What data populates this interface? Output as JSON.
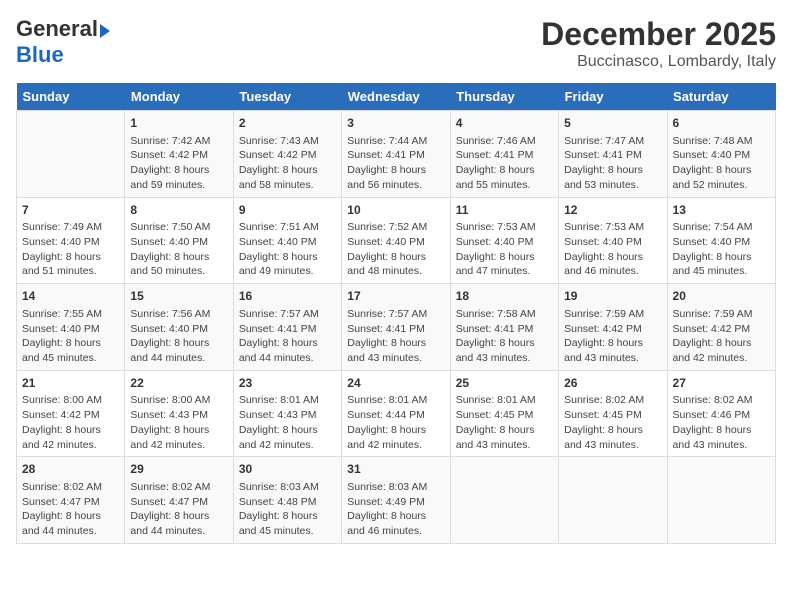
{
  "header": {
    "logo_general": "General",
    "logo_blue": "Blue",
    "title": "December 2025",
    "subtitle": "Buccinasco, Lombardy, Italy"
  },
  "days_of_week": [
    "Sunday",
    "Monday",
    "Tuesday",
    "Wednesday",
    "Thursday",
    "Friday",
    "Saturday"
  ],
  "weeks": [
    [
      {
        "day": "",
        "content": ""
      },
      {
        "day": "1",
        "content": "Sunrise: 7:42 AM\nSunset: 4:42 PM\nDaylight: 8 hours\nand 59 minutes."
      },
      {
        "day": "2",
        "content": "Sunrise: 7:43 AM\nSunset: 4:42 PM\nDaylight: 8 hours\nand 58 minutes."
      },
      {
        "day": "3",
        "content": "Sunrise: 7:44 AM\nSunset: 4:41 PM\nDaylight: 8 hours\nand 56 minutes."
      },
      {
        "day": "4",
        "content": "Sunrise: 7:46 AM\nSunset: 4:41 PM\nDaylight: 8 hours\nand 55 minutes."
      },
      {
        "day": "5",
        "content": "Sunrise: 7:47 AM\nSunset: 4:41 PM\nDaylight: 8 hours\nand 53 minutes."
      },
      {
        "day": "6",
        "content": "Sunrise: 7:48 AM\nSunset: 4:40 PM\nDaylight: 8 hours\nand 52 minutes."
      }
    ],
    [
      {
        "day": "7",
        "content": "Sunrise: 7:49 AM\nSunset: 4:40 PM\nDaylight: 8 hours\nand 51 minutes."
      },
      {
        "day": "8",
        "content": "Sunrise: 7:50 AM\nSunset: 4:40 PM\nDaylight: 8 hours\nand 50 minutes."
      },
      {
        "day": "9",
        "content": "Sunrise: 7:51 AM\nSunset: 4:40 PM\nDaylight: 8 hours\nand 49 minutes."
      },
      {
        "day": "10",
        "content": "Sunrise: 7:52 AM\nSunset: 4:40 PM\nDaylight: 8 hours\nand 48 minutes."
      },
      {
        "day": "11",
        "content": "Sunrise: 7:53 AM\nSunset: 4:40 PM\nDaylight: 8 hours\nand 47 minutes."
      },
      {
        "day": "12",
        "content": "Sunrise: 7:53 AM\nSunset: 4:40 PM\nDaylight: 8 hours\nand 46 minutes."
      },
      {
        "day": "13",
        "content": "Sunrise: 7:54 AM\nSunset: 4:40 PM\nDaylight: 8 hours\nand 45 minutes."
      }
    ],
    [
      {
        "day": "14",
        "content": "Sunrise: 7:55 AM\nSunset: 4:40 PM\nDaylight: 8 hours\nand 45 minutes."
      },
      {
        "day": "15",
        "content": "Sunrise: 7:56 AM\nSunset: 4:40 PM\nDaylight: 8 hours\nand 44 minutes."
      },
      {
        "day": "16",
        "content": "Sunrise: 7:57 AM\nSunset: 4:41 PM\nDaylight: 8 hours\nand 44 minutes."
      },
      {
        "day": "17",
        "content": "Sunrise: 7:57 AM\nSunset: 4:41 PM\nDaylight: 8 hours\nand 43 minutes."
      },
      {
        "day": "18",
        "content": "Sunrise: 7:58 AM\nSunset: 4:41 PM\nDaylight: 8 hours\nand 43 minutes."
      },
      {
        "day": "19",
        "content": "Sunrise: 7:59 AM\nSunset: 4:42 PM\nDaylight: 8 hours\nand 43 minutes."
      },
      {
        "day": "20",
        "content": "Sunrise: 7:59 AM\nSunset: 4:42 PM\nDaylight: 8 hours\nand 42 minutes."
      }
    ],
    [
      {
        "day": "21",
        "content": "Sunrise: 8:00 AM\nSunset: 4:42 PM\nDaylight: 8 hours\nand 42 minutes."
      },
      {
        "day": "22",
        "content": "Sunrise: 8:00 AM\nSunset: 4:43 PM\nDaylight: 8 hours\nand 42 minutes."
      },
      {
        "day": "23",
        "content": "Sunrise: 8:01 AM\nSunset: 4:43 PM\nDaylight: 8 hours\nand 42 minutes."
      },
      {
        "day": "24",
        "content": "Sunrise: 8:01 AM\nSunset: 4:44 PM\nDaylight: 8 hours\nand 42 minutes."
      },
      {
        "day": "25",
        "content": "Sunrise: 8:01 AM\nSunset: 4:45 PM\nDaylight: 8 hours\nand 43 minutes."
      },
      {
        "day": "26",
        "content": "Sunrise: 8:02 AM\nSunset: 4:45 PM\nDaylight: 8 hours\nand 43 minutes."
      },
      {
        "day": "27",
        "content": "Sunrise: 8:02 AM\nSunset: 4:46 PM\nDaylight: 8 hours\nand 43 minutes."
      }
    ],
    [
      {
        "day": "28",
        "content": "Sunrise: 8:02 AM\nSunset: 4:47 PM\nDaylight: 8 hours\nand 44 minutes."
      },
      {
        "day": "29",
        "content": "Sunrise: 8:02 AM\nSunset: 4:47 PM\nDaylight: 8 hours\nand 44 minutes."
      },
      {
        "day": "30",
        "content": "Sunrise: 8:03 AM\nSunset: 4:48 PM\nDaylight: 8 hours\nand 45 minutes."
      },
      {
        "day": "31",
        "content": "Sunrise: 8:03 AM\nSunset: 4:49 PM\nDaylight: 8 hours\nand 46 minutes."
      },
      {
        "day": "",
        "content": ""
      },
      {
        "day": "",
        "content": ""
      },
      {
        "day": "",
        "content": ""
      }
    ]
  ]
}
